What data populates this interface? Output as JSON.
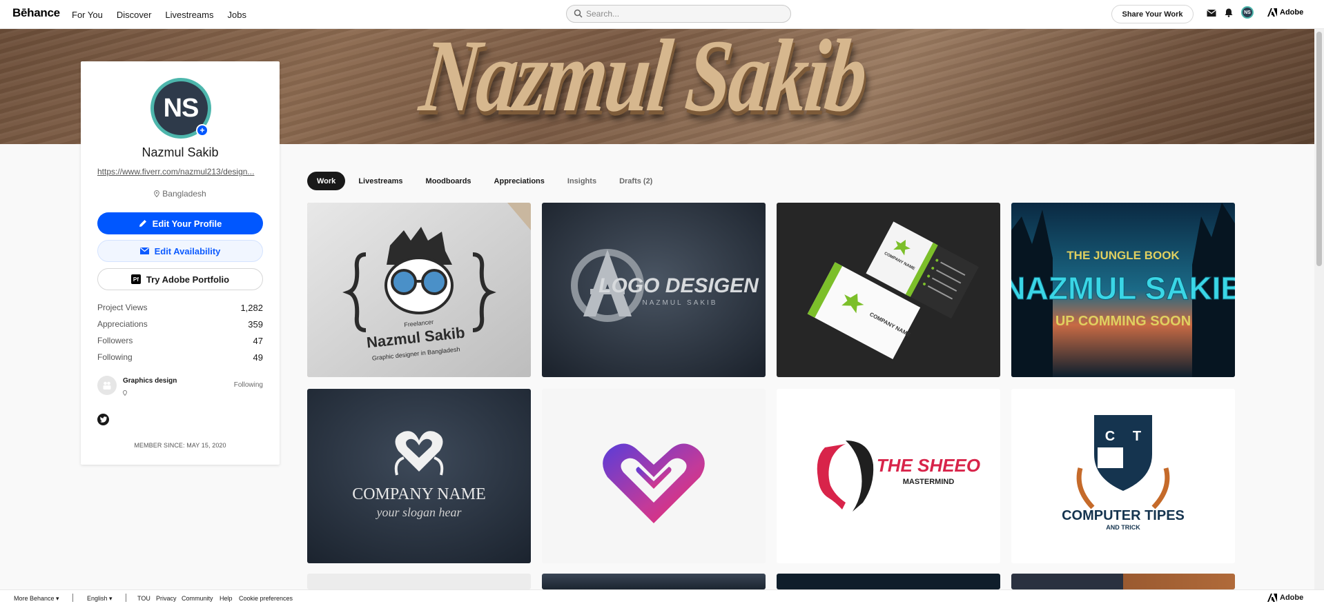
{
  "nav": {
    "logo": "Bēhance",
    "links": [
      "For You",
      "Discover",
      "Livestreams",
      "Jobs"
    ],
    "search_placeholder": "Search...",
    "share_label": "Share Your Work",
    "avatar_initials": "NS",
    "adobe_label": "Adobe"
  },
  "banner": {
    "text": "Nazmul Sakib"
  },
  "profile": {
    "initials": "NS",
    "name": "Nazmul Sakib",
    "link": "https://www.fiverr.com/nazmul213/design...",
    "location": "Bangladesh",
    "edit_profile_label": "Edit Your Profile",
    "edit_availability_label": "Edit Availability",
    "adobe_portfolio_label": "Try Adobe Portfolio",
    "adobe_portfolio_badge": "Pf",
    "stats": [
      {
        "label": "Project Views",
        "value": "1,282"
      },
      {
        "label": "Appreciations",
        "value": "359"
      },
      {
        "label": "Followers",
        "value": "47"
      },
      {
        "label": "Following",
        "value": "49"
      }
    ],
    "team": {
      "name": "Graphics design",
      "status": "Following"
    },
    "member_since": "MEMBER SINCE: MAY 15, 2020"
  },
  "tabs": [
    "Work",
    "Livestreams",
    "Moodboards",
    "Appreciations",
    "Insights",
    "Drafts (2)"
  ],
  "projects": {
    "p1": {
      "line1": "Freelancer",
      "line2": "Nazmul Sakib",
      "line3": "Graphic designer in Bangladesh"
    },
    "p2": {
      "line1": "LOGO DESIGEN",
      "line2": "NAZMUL SAKIB"
    },
    "p3": {
      "line1": "COMPANY NAME",
      "line2": "COMPANY NAME"
    },
    "p4": {
      "line1": "THE JUNGLE BOOK",
      "line2": "NAZMUL SAKIB",
      "line3": "UP COMMING SOON"
    },
    "p5": {
      "line1": "COMPANY NAME",
      "line2": "your slogan hear"
    },
    "p7": {
      "line1": "THE SHEEO",
      "line2": "MASTERMIND"
    },
    "p8": {
      "letter1": "C",
      "letter2": "T",
      "line1": "COMPUTER TIPES",
      "line2": "AND TRICK"
    }
  },
  "footer": {
    "more": "More Behance",
    "language": "English",
    "links": [
      "TOU",
      "Privacy",
      "Community",
      "Help",
      "Cookie preferences"
    ],
    "adobe_label": "Adobe"
  },
  "colors": {
    "accent": "#0057ff",
    "avatar_ring": "#4db6ac"
  }
}
